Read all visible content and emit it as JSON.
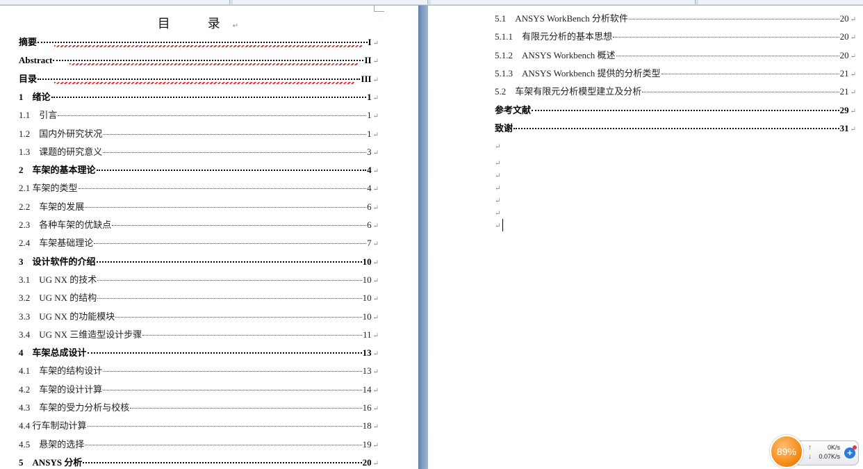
{
  "document": {
    "title": "目　录",
    "paragraph_mark": "↵"
  },
  "toc_left": [
    {
      "text": "摘要",
      "page": "I",
      "level": 1
    },
    {
      "text": "Abstract",
      "page": "II",
      "level": 1
    },
    {
      "text": "目录",
      "page": "III",
      "level": 1
    },
    {
      "text": "1　绪论",
      "page": "1",
      "level": 1
    },
    {
      "text": "1.1　引言",
      "page": "1",
      "level": 2
    },
    {
      "text": "1.2　国内外研究状况",
      "page": "1",
      "level": 2
    },
    {
      "text": "1.3　课题的研究意义",
      "page": "3",
      "level": 2
    },
    {
      "text": "2　车架的基本理论",
      "page": "4",
      "level": 1
    },
    {
      "text": "2.1 车架的类型",
      "page": "4",
      "level": 2
    },
    {
      "text": "2.2　车架的发展",
      "page": "6",
      "level": 2
    },
    {
      "text": "2.3　各种车架的优缺点",
      "page": "6",
      "level": 2
    },
    {
      "text": "2.4　车架基础理论",
      "page": "7",
      "level": 2
    },
    {
      "text": "3　设计软件的介绍",
      "page": "10",
      "level": 1
    },
    {
      "text": "3.1　UG NX 的技术",
      "page": "10",
      "level": 2
    },
    {
      "text": "3.2　UG NX 的结构",
      "page": "10",
      "level": 2
    },
    {
      "text": "3.3　UG NX 的功能模块",
      "page": "10",
      "level": 2
    },
    {
      "text": "3.4　UG NX 三维造型设计步骤",
      "page": "11",
      "level": 2
    },
    {
      "text": "4　车架总成设计",
      "page": "13",
      "level": 1
    },
    {
      "text": "4.1　车架的结构设计",
      "page": "13",
      "level": 2
    },
    {
      "text": "4.2　车架的设计计算",
      "page": "14",
      "level": 2
    },
    {
      "text": "4.3　车架的受力分析与校核",
      "page": "16",
      "level": 2
    },
    {
      "text": "4.4 行车制动计算",
      "page": "18",
      "level": 2
    },
    {
      "text": "4.5　悬架的选择",
      "page": "19",
      "level": 2
    },
    {
      "text": "5　ANSYS 分析",
      "page": "20",
      "level": 1
    }
  ],
  "toc_right": [
    {
      "text": "5.1　ANSYS WorkBench 分析软件",
      "page": "20",
      "level": 2
    },
    {
      "text": "5.1.1　有限元分析的基本思想",
      "page": "20",
      "level": 2
    },
    {
      "text": "5.1.2　ANSYS Workbench 概述",
      "page": "20",
      "level": 2
    },
    {
      "text": "5.1.3　ANSYS Workbench 提供的分析类型",
      "page": "21",
      "level": 2
    },
    {
      "text": "5.2　车架有限元分析模型建立及分析",
      "page": "21",
      "level": 2
    },
    {
      "text": "参考文献",
      "page": "29",
      "level": 1
    },
    {
      "text": "致谢",
      "page": "31",
      "level": 1
    }
  ],
  "net_monitor": {
    "percent": "89%",
    "upload": "0K/s",
    "download": "0.07K/s",
    "accent": "#f7901e"
  }
}
